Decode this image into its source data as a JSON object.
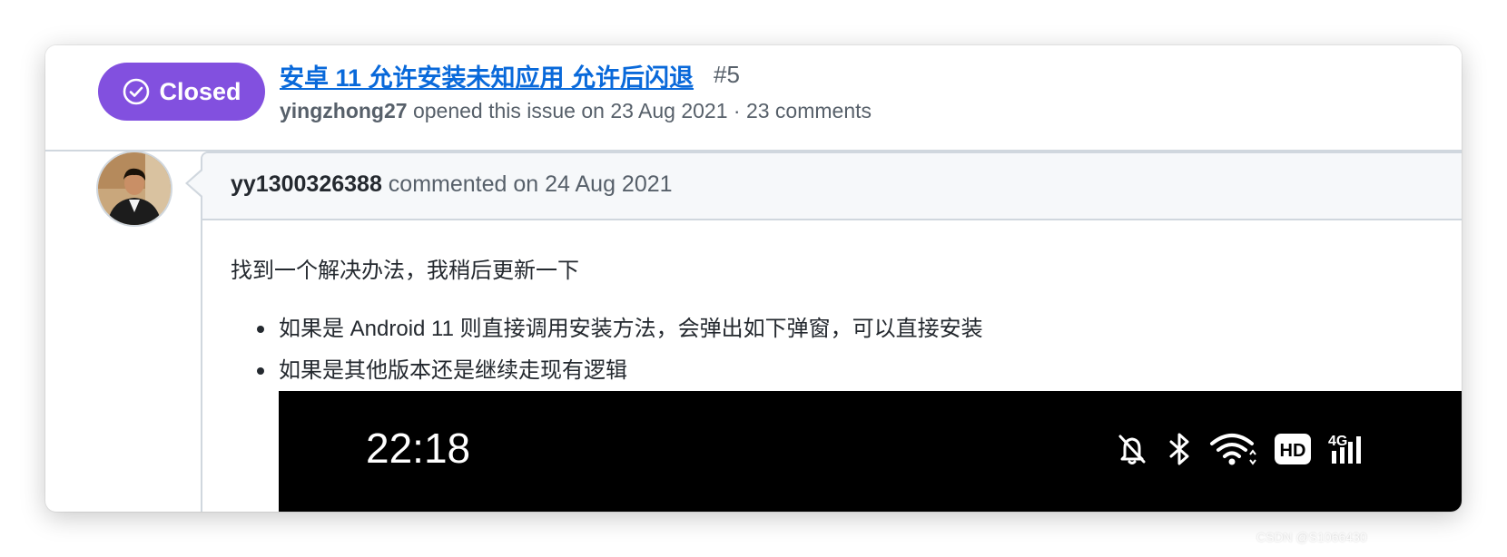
{
  "issue": {
    "state_label": "Closed",
    "state_color": "#8250df",
    "title": "安卓 11 允许安装未知应用 允许后闪退",
    "number": "#5",
    "author": "yingzhong27",
    "meta_text": " opened this issue on 23 Aug 2021 · 23 comments"
  },
  "comment": {
    "author": "yy1300326388",
    "header_text": " commented on 24 Aug 2021",
    "body_text": "找到一个解决办法，我稍后更新一下",
    "list_items": [
      "如果是 Android 11 则直接调用安装方法，会弹出如下弹窗，可以直接安装",
      "如果是其他版本还是继续走现有逻辑"
    ]
  },
  "embedded_screenshot": {
    "time": "22:18",
    "icons": [
      "bell-off-icon",
      "bluetooth-icon",
      "wifi-icon",
      "hd-icon",
      "4g-signal-icon"
    ],
    "hd_label": "HD",
    "network_label": "4G"
  },
  "watermark": "CSDN @S1066430"
}
